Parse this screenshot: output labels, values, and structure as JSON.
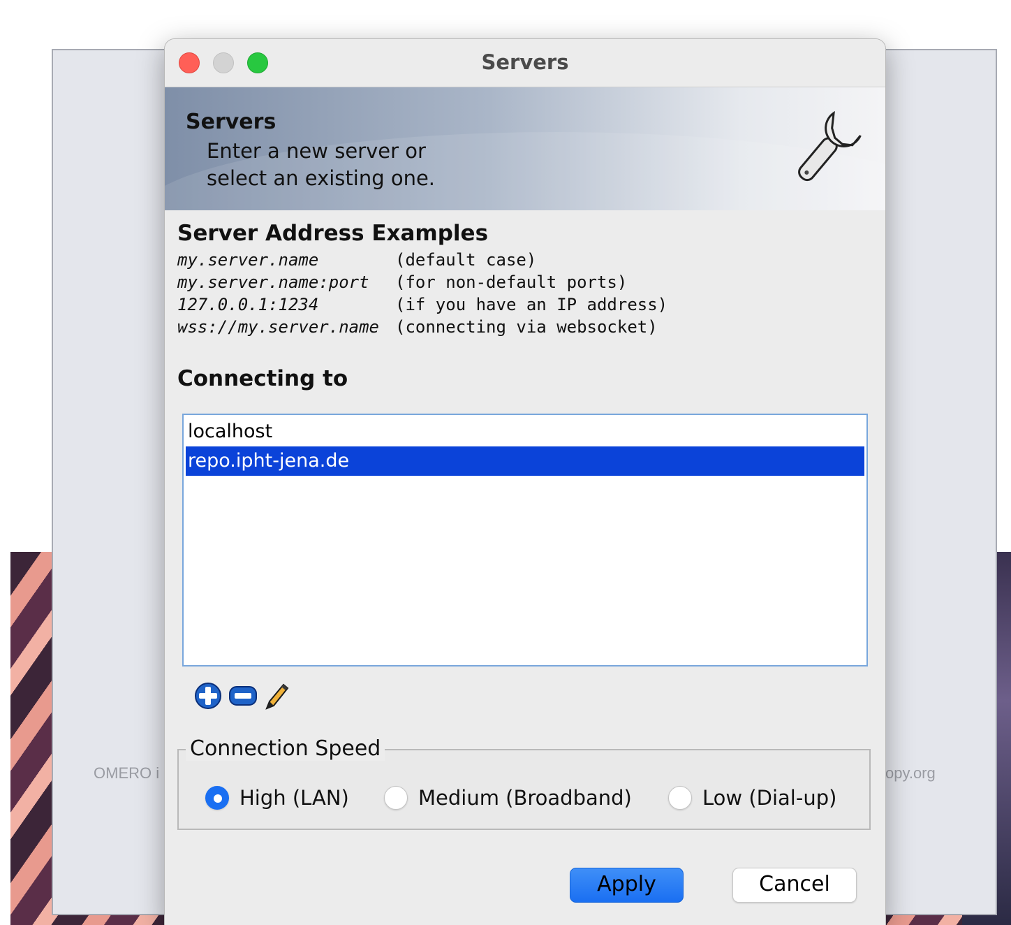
{
  "background": {
    "left_text": "OMERO i",
    "right_text": "opy.org"
  },
  "window": {
    "title": "Servers"
  },
  "banner": {
    "title": "Servers",
    "subtitle_line1": "Enter a new server or",
    "subtitle_line2": "select an existing one.",
    "icon": "wrench-icon"
  },
  "examples": {
    "title": "Server Address Examples",
    "rows": [
      {
        "address": "my.server.name",
        "note": "(default case)"
      },
      {
        "address": "my.server.name:port",
        "note": "(for non-default ports)"
      },
      {
        "address": "127.0.0.1:1234",
        "note": "(if you have an IP address)"
      },
      {
        "address": "wss://my.server.name",
        "note": "(connecting via websocket)"
      }
    ]
  },
  "connecting": {
    "title": "Connecting to",
    "servers": [
      {
        "name": "localhost",
        "selected": false
      },
      {
        "name": "repo.ipht-jena.de",
        "selected": true
      }
    ],
    "tools": [
      "add-icon",
      "remove-icon",
      "edit-pen-icon"
    ]
  },
  "speed": {
    "legend": "Connection Speed",
    "options": [
      {
        "label": "High (LAN)",
        "checked": true
      },
      {
        "label": "Medium (Broadband)",
        "checked": false
      },
      {
        "label": "Low (Dial-up)",
        "checked": false
      }
    ]
  },
  "buttons": {
    "apply": "Apply",
    "cancel": "Cancel"
  },
  "colors": {
    "selection": "#0b43d9",
    "accent": "#1a6ff2",
    "list_border": "#79a7dc"
  }
}
